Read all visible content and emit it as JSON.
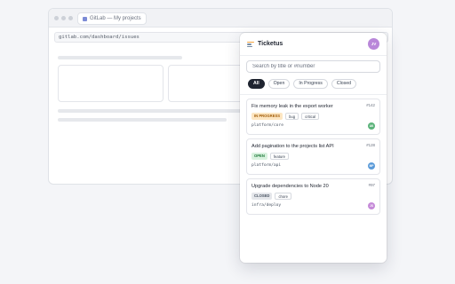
{
  "browser": {
    "tab_title": "GitLab — My projects",
    "url": "gitlab.com/dashboard/issues"
  },
  "popup": {
    "title": "Ticketus",
    "user_initials": "JV",
    "search_placeholder": "Search by title or #number",
    "filters": [
      "All",
      "Open",
      "In Progress",
      "Closed"
    ],
    "active_filter": "All",
    "tickets": [
      {
        "title": "Fix memory leak in the export worker",
        "number": "#142",
        "status": "IN PROGRESS",
        "status_color": "#fde6c2",
        "status_text_color": "#a15c07",
        "labels": [
          "bug",
          "critical"
        ],
        "repo": "platform/core",
        "assignee": "AK",
        "assignee_color": "#5bb37a"
      },
      {
        "title": "Add pagination to the projects list API",
        "number": "#128",
        "status": "OPEN",
        "status_color": "#d9f2df",
        "status_text_color": "#1f7a3a",
        "labels": [
          "feature"
        ],
        "repo": "platform/api",
        "assignee": "MP",
        "assignee_color": "#5b9bd9"
      },
      {
        "title": "Upgrade dependencies to Node 20",
        "number": "#97",
        "status": "CLOSED",
        "status_color": "#e5e7eb",
        "status_text_color": "#4b5563",
        "labels": [
          "chore"
        ],
        "repo": "infra/deploy",
        "assignee": "JS",
        "assignee_color": "#c58ad8"
      }
    ]
  }
}
